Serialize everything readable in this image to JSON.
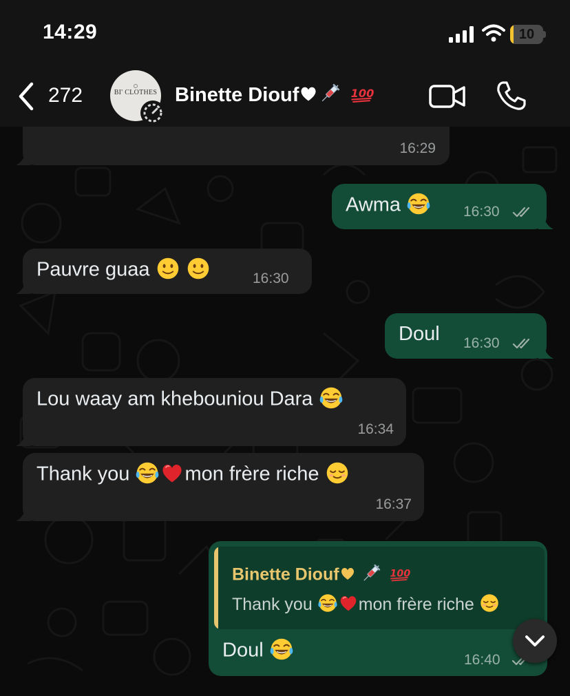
{
  "status_bar": {
    "time": "14:29",
    "battery": "10",
    "battery_level": 0.1,
    "battery_color": "#f4c430"
  },
  "header": {
    "back_count": "272",
    "contact_name": "Binette Diouf",
    "contact_name_emojis": [
      "white-heart",
      "syringe",
      "hundred-points"
    ],
    "avatar_text": "BI' CLOTHES",
    "icons": [
      "chevron-left-icon",
      "video-call-icon",
      "phone-icon"
    ]
  },
  "colors": {
    "incoming_bubble": "#202020",
    "outgoing_bubble": "#134d37",
    "quote_accent": "#e7c66d",
    "background": "#0b0b0b"
  },
  "messages": [
    {
      "direction": "incoming",
      "text": "",
      "time": "16:29",
      "note_cut_off": true
    },
    {
      "direction": "outgoing",
      "text": "Awma",
      "emojis": [
        "tears-of-joy"
      ],
      "time": "16:30",
      "status": "read"
    },
    {
      "direction": "incoming",
      "text": "Pauvre guaa",
      "emojis": [
        "slightly-smiling",
        "slightly-smiling"
      ],
      "time": "16:30"
    },
    {
      "direction": "outgoing",
      "text": "Doul",
      "emojis": [],
      "time": "16:30",
      "status": "read"
    },
    {
      "direction": "incoming",
      "text": "Lou waay am khebouniou Dara",
      "emojis": [
        "tears-of-joy"
      ],
      "time": "16:34"
    },
    {
      "direction": "incoming",
      "text_before": "Thank you",
      "text_after": "mon frère riche",
      "emojis": [
        "tears-of-joy",
        "red-heart",
        "relieved"
      ],
      "time": "16:37"
    },
    {
      "direction": "outgoing",
      "quote": {
        "name": "Binette Diouf",
        "name_emojis": [
          "yellow-heart",
          "syringe",
          "hundred-points"
        ],
        "text_before": "Thank you",
        "text_after": "mon frère riche"
      },
      "text": "Doul",
      "emojis": [
        "tears-of-joy"
      ],
      "time": "16:40",
      "status": "read"
    }
  ]
}
